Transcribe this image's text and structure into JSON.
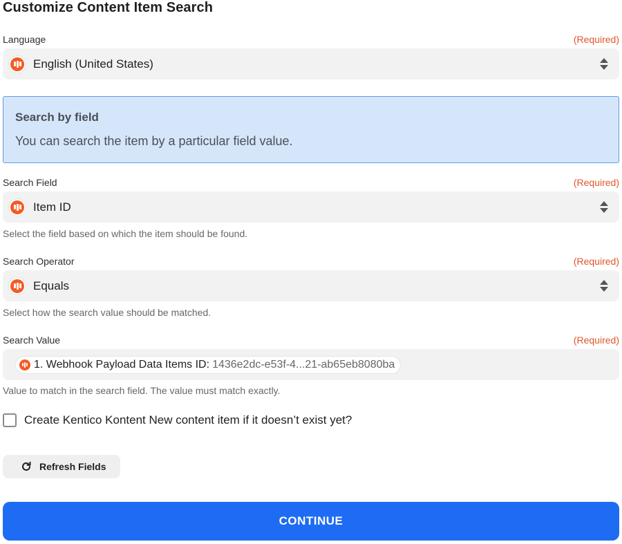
{
  "page": {
    "title": "Customize Content Item Search"
  },
  "colors": {
    "accent": "#1e6cf3",
    "required": "#e0552a",
    "app_brand": "#f25b25",
    "info_bg": "#d5e6fb"
  },
  "language": {
    "label": "Language",
    "required": "(Required)",
    "value": "English (United States)",
    "icon": "kontent-app-icon"
  },
  "info": {
    "heading": "Search by field",
    "body": "You can search the item by a particular field value."
  },
  "search_field": {
    "label": "Search Field",
    "required": "(Required)",
    "value": "Item ID",
    "hint": "Select the field based on which the item should be found."
  },
  "search_operator": {
    "label": "Search Operator",
    "required": "(Required)",
    "value": "Equals",
    "hint": "Select how the search value should be matched."
  },
  "search_value": {
    "label": "Search Value",
    "required": "(Required)",
    "pill_label": "1. Webhook Payload Data Items ID:",
    "pill_value": "1436e2dc-e53f-4...21-ab65eb8080ba",
    "hint": "Value to match in the search field. The value must match exactly."
  },
  "create_option": {
    "label": "Create Kentico Kontent New content item if it doesn’t exist yet?",
    "checked": false
  },
  "buttons": {
    "refresh": "Refresh Fields",
    "continue": "CONTINUE"
  }
}
